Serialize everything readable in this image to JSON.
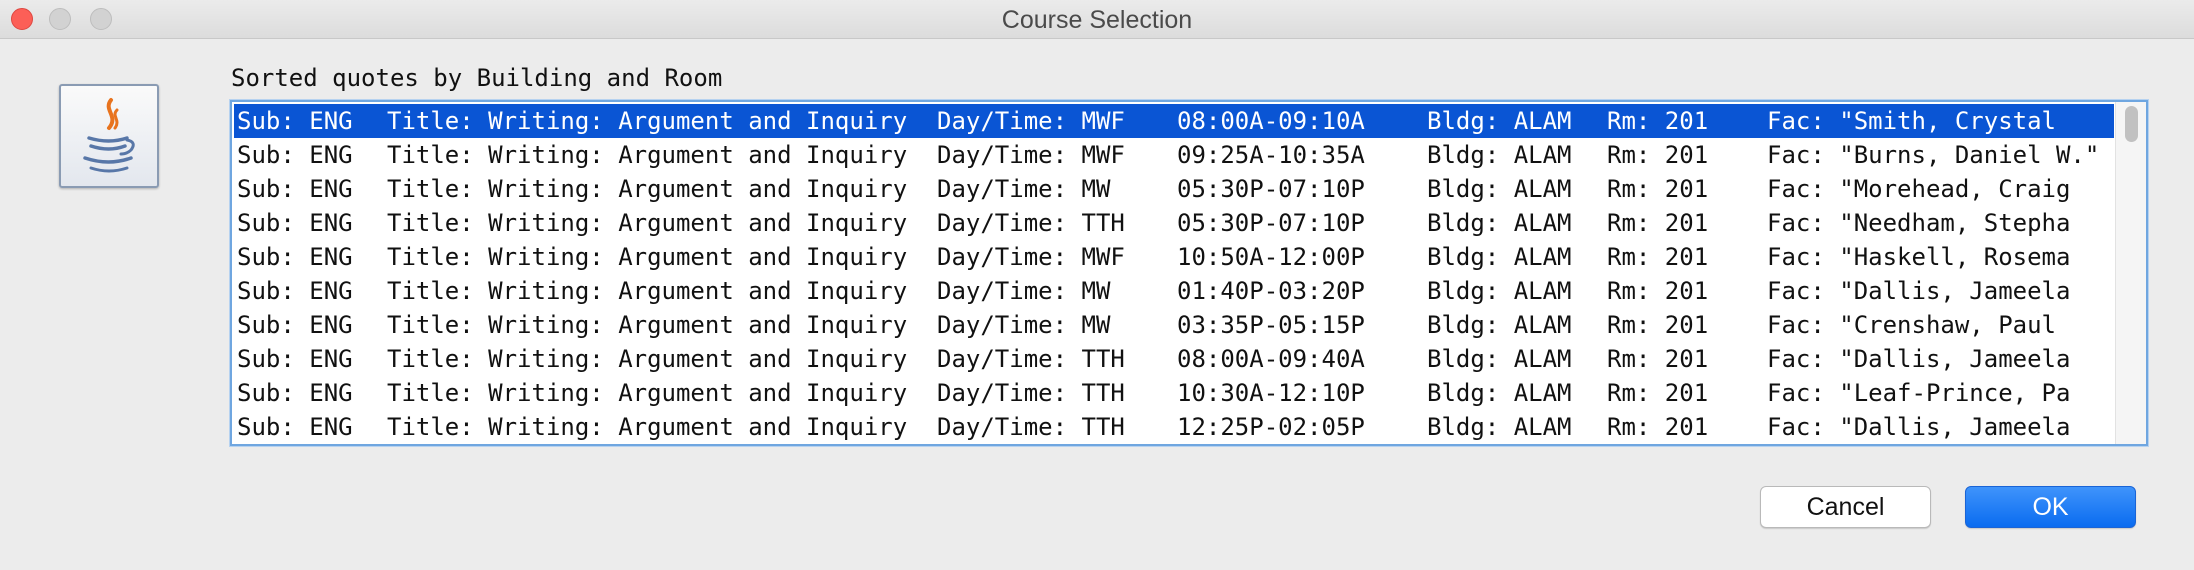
{
  "window": {
    "title": "Course Selection",
    "controls": [
      "close-button",
      "minimize-button",
      "zoom-button"
    ]
  },
  "dialog": {
    "icon": "java-coffee-cup-icon",
    "message": "Sorted quotes by Building and Room",
    "rows": [
      {
        "sub": "Sub: ENG",
        "title": "Title: Writing: Argument and Inquiry",
        "day": "Day/Time: MWF",
        "time": "08:00A-09:10A",
        "bldg": "Bldg: ALAM",
        "rm": "Rm: 201",
        "fac": "Fac: \"Smith, Crystal",
        "selected": true
      },
      {
        "sub": "Sub: ENG",
        "title": "Title: Writing: Argument and Inquiry",
        "day": "Day/Time: MWF",
        "time": "09:25A-10:35A",
        "bldg": "Bldg: ALAM",
        "rm": "Rm: 201",
        "fac": "Fac: \"Burns, Daniel W.\"",
        "selected": false
      },
      {
        "sub": "Sub: ENG",
        "title": "Title: Writing: Argument and Inquiry",
        "day": "Day/Time: MW",
        "time": "05:30P-07:10P",
        "bldg": "Bldg: ALAM",
        "rm": "Rm: 201",
        "fac": "Fac: \"Morehead, Craig",
        "selected": false
      },
      {
        "sub": "Sub: ENG",
        "title": "Title: Writing: Argument and Inquiry",
        "day": "Day/Time: TTH",
        "time": "05:30P-07:10P",
        "bldg": "Bldg: ALAM",
        "rm": "Rm: 201",
        "fac": "Fac: \"Needham, Stepha",
        "selected": false
      },
      {
        "sub": "Sub: ENG",
        "title": "Title: Writing: Argument and Inquiry",
        "day": "Day/Time: MWF",
        "time": "10:50A-12:00P",
        "bldg": "Bldg: ALAM",
        "rm": "Rm: 201",
        "fac": "Fac: \"Haskell, Rosema",
        "selected": false
      },
      {
        "sub": "Sub: ENG",
        "title": "Title: Writing: Argument and Inquiry",
        "day": "Day/Time: MW",
        "time": "01:40P-03:20P",
        "bldg": "Bldg: ALAM",
        "rm": "Rm: 201",
        "fac": "Fac: \"Dallis, Jameela",
        "selected": false
      },
      {
        "sub": "Sub: ENG",
        "title": "Title: Writing: Argument and Inquiry",
        "day": "Day/Time: MW",
        "time": "03:35P-05:15P",
        "bldg": "Bldg: ALAM",
        "rm": "Rm: 201",
        "fac": "Fac: \"Crenshaw, Paul",
        "selected": false
      },
      {
        "sub": "Sub: ENG",
        "title": "Title: Writing: Argument and Inquiry",
        "day": "Day/Time: TTH",
        "time": "08:00A-09:40A",
        "bldg": "Bldg: ALAM",
        "rm": "Rm: 201",
        "fac": "Fac: \"Dallis, Jameela",
        "selected": false
      },
      {
        "sub": "Sub: ENG",
        "title": "Title: Writing: Argument and Inquiry",
        "day": "Day/Time: TTH",
        "time": "10:30A-12:10P",
        "bldg": "Bldg: ALAM",
        "rm": "Rm: 201",
        "fac": "Fac: \"Leaf-Prince, Pa",
        "selected": false
      },
      {
        "sub": "Sub: ENG",
        "title": "Title: Writing: Argument and Inquiry",
        "day": "Day/Time: TTH",
        "time": "12:25P-02:05P",
        "bldg": "Bldg: ALAM",
        "rm": "Rm: 201",
        "fac": "Fac: \"Dallis, Jameela",
        "selected": false
      }
    ],
    "buttons": {
      "cancel_label": "Cancel",
      "ok_label": "OK"
    }
  },
  "colors": {
    "selection": "#0a55d4",
    "close": "#fc5f57",
    "default_button": "#0a6cf0",
    "focus_ring": "#6fa6e0"
  }
}
